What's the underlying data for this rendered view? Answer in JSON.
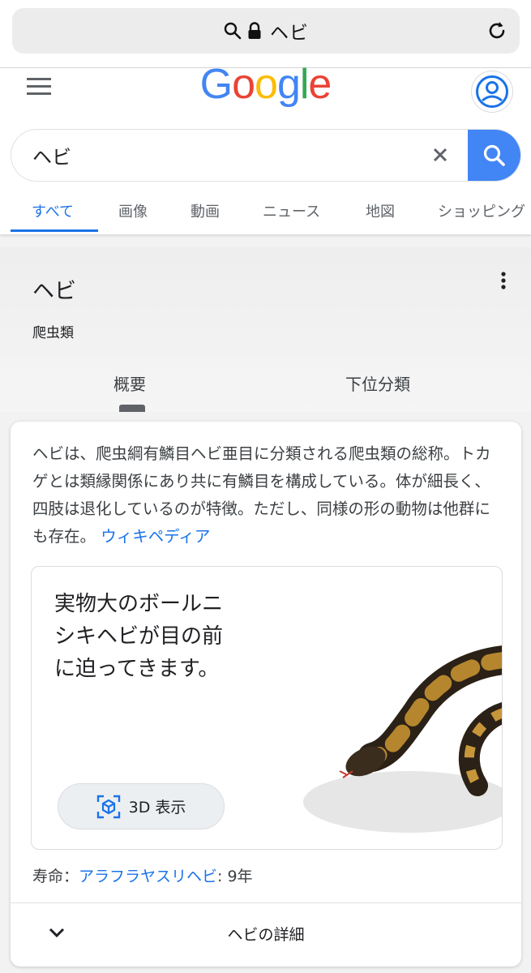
{
  "browser": {
    "url_text": "ヘビ",
    "icons": [
      "search-icon",
      "lock-icon",
      "reload-icon"
    ]
  },
  "header": {
    "logo_letters": [
      {
        "ch": "G",
        "color": "#4285F4"
      },
      {
        "ch": "o",
        "color": "#EA4335"
      },
      {
        "ch": "o",
        "color": "#FBBC05"
      },
      {
        "ch": "g",
        "color": "#4285F4"
      },
      {
        "ch": "l",
        "color": "#34A853"
      },
      {
        "ch": "e",
        "color": "#EA4335"
      }
    ],
    "icons": [
      "menu-icon",
      "account-icon"
    ]
  },
  "search": {
    "query": "ヘビ",
    "icons": [
      "clear-icon",
      "search-icon"
    ]
  },
  "tabs": [
    {
      "label": "すべて",
      "active": true
    },
    {
      "label": "画像",
      "active": false
    },
    {
      "label": "動画",
      "active": false
    },
    {
      "label": "ニュース",
      "active": false
    },
    {
      "label": "地図",
      "active": false
    },
    {
      "label": "ショッピング",
      "active": false
    }
  ],
  "knowledge_panel": {
    "title": "ヘビ",
    "subtitle": "爬虫類",
    "tabs": [
      {
        "label": "概要",
        "active": true
      },
      {
        "label": "下位分類",
        "active": false
      }
    ],
    "description": "ヘビは、爬虫綱有鱗目ヘビ亜目に分類される爬虫類の総称。トカゲとは類縁関係にあり共に有鱗目を構成している。体が細長く、四肢は退化しているのが特徴。ただし、同様の形の動物は他群にも存在。",
    "source_link": "ウィキペディア",
    "ar_card": {
      "text": "実物大のボールニシキヘビが目の前に迫ってきます。",
      "button_label": "3D 表示"
    },
    "lifespan": {
      "label": "寿命：",
      "link": "アラフラヤスリヘビ",
      "value": ": 9年"
    },
    "expand_label": "ヘビの詳細"
  },
  "colors": {
    "accent": "#1a73e8",
    "search_button": "#4285f4"
  }
}
